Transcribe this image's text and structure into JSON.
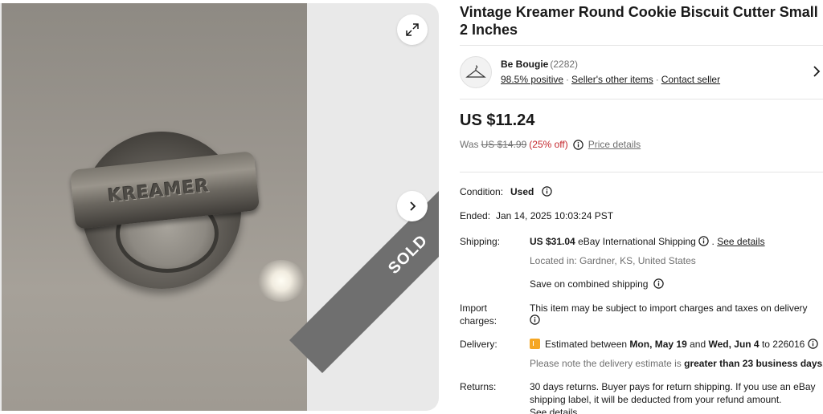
{
  "gallery": {
    "stamp_text": "KREAMER",
    "sold_label": "SOLD",
    "expand_icon": "expand-icon",
    "next_icon": "chevron-right-icon"
  },
  "listing": {
    "title": "Vintage Kreamer Round Cookie Biscuit Cutter Small 2 Inches"
  },
  "seller": {
    "avatar_icon": "hanger-icon",
    "name": "Be Bougie",
    "feedback_count": "(2282)",
    "positive": "98.5% positive",
    "other_items": "Seller's other items",
    "contact": "Contact seller",
    "separator": "·"
  },
  "pricing": {
    "price": "US $11.24",
    "was_label": "Was",
    "was_price": "US $14.99",
    "discount": "(25% off)",
    "price_details": "Price details"
  },
  "details": {
    "condition_label": "Condition:",
    "condition_value": "Used",
    "ended_label": "Ended:",
    "ended_value": "Jan 14, 2025 10:03:24 PST",
    "shipping_label": "Shipping:",
    "shipping_cost": "US $31.04",
    "shipping_method": "eBay International Shipping",
    "see_details": "See details",
    "located": "Located in: Gardner, KS, United States",
    "combined": "Save on combined shipping",
    "import_label_1": "Import",
    "import_label_2": "charges:",
    "import_text": "This item may be subject to import charges and taxes on delivery",
    "delivery_label": "Delivery:",
    "delivery_prefix": "Estimated between",
    "delivery_start": "Mon, May 19",
    "delivery_and": "and",
    "delivery_end": "Wed, Jun 4",
    "delivery_to": "to 226016",
    "delivery_note_prefix": "Please note the delivery estimate is",
    "delivery_note_bold": "greater than 23 business days.",
    "returns_label": "Returns:",
    "returns_line1": "30 days returns. Buyer pays for return shipping. If you use an eBay",
    "returns_line2": "shipping label, it will be deducted from your refund amount.",
    "returns_line3": "See details"
  },
  "colors": {
    "discount_red": "#c4262c",
    "flag_orange": "#f5a623",
    "ribbon_gray": "#6f6f6f"
  }
}
